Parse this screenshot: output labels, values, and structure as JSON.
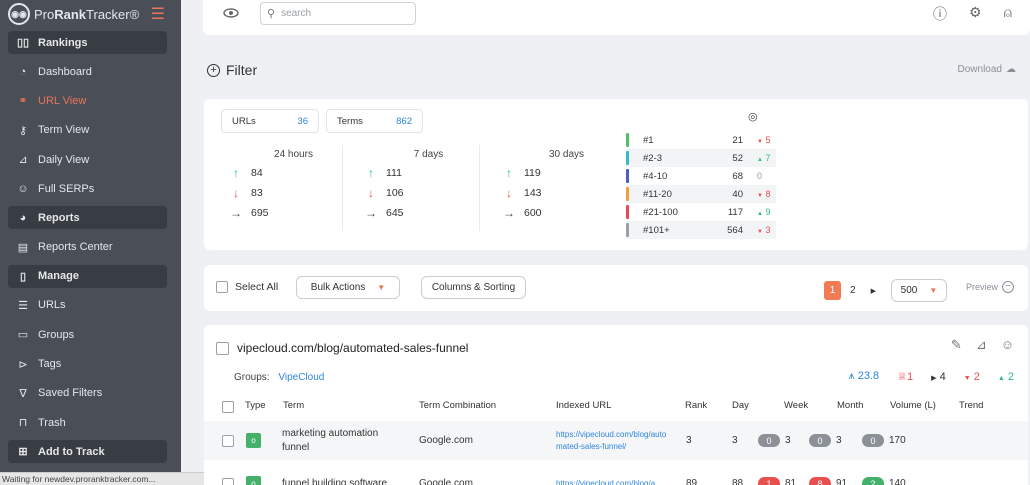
{
  "brand": {
    "name_prefix": "Pro",
    "name_bold": "Rank",
    "name_suffix": "Tracker®"
  },
  "sidebar": {
    "items": [
      {
        "label": "Rankings",
        "type": "section",
        "icon": "rankings-icon",
        "glyph": "▯▯"
      },
      {
        "label": "Dashboard",
        "type": "item",
        "icon": "dashboard-icon",
        "glyph": "◔"
      },
      {
        "label": "URL View",
        "type": "item",
        "icon": "link-icon",
        "glyph": "⚭",
        "active": true
      },
      {
        "label": "Term View",
        "type": "item",
        "icon": "key-icon",
        "glyph": "⚷"
      },
      {
        "label": "Daily View",
        "type": "item",
        "icon": "chart-line-icon",
        "glyph": "⊿"
      },
      {
        "label": "Full SERPs",
        "type": "item",
        "icon": "robot-icon",
        "glyph": "☺"
      },
      {
        "label": "Reports",
        "type": "section",
        "icon": "pie-icon",
        "glyph": "◕"
      },
      {
        "label": "Reports Center",
        "type": "item",
        "icon": "report-icon",
        "glyph": "▤"
      },
      {
        "label": "Manage",
        "type": "section",
        "icon": "manage-icon",
        "glyph": "▯"
      },
      {
        "label": "URLs",
        "type": "item",
        "icon": "list-icon",
        "glyph": "☰"
      },
      {
        "label": "Groups",
        "type": "item",
        "icon": "folder-icon",
        "glyph": "▭"
      },
      {
        "label": "Tags",
        "type": "item",
        "icon": "tag-icon",
        "glyph": "⊳"
      },
      {
        "label": "Saved Filters",
        "type": "item",
        "icon": "filter-icon",
        "glyph": "∇"
      },
      {
        "label": "Trash",
        "type": "item",
        "icon": "trash-icon",
        "glyph": "⊓"
      },
      {
        "label": "Add to Track",
        "type": "section",
        "icon": "add-box-icon",
        "glyph": "⊞"
      }
    ]
  },
  "status_bar": "Waiting for newdev.proranktracker.com...",
  "search": {
    "placeholder": "search"
  },
  "filter": {
    "title": "Filter",
    "download": "Download"
  },
  "summary": {
    "urls_label": "URLs",
    "urls_count": "36",
    "terms_label": "Terms",
    "terms_count": "862",
    "periods": [
      {
        "label": "24 hours",
        "up": "84",
        "down": "83",
        "same": "695"
      },
      {
        "label": "7 days",
        "up": "111",
        "down": "106",
        "same": "645"
      },
      {
        "label": "30 days",
        "up": "119",
        "down": "143",
        "same": "600"
      }
    ],
    "ranks": [
      {
        "label": "#1",
        "count": "21",
        "change": "5",
        "dir": "down",
        "color": "#4cc06a"
      },
      {
        "label": "#2-3",
        "count": "52",
        "change": "7",
        "dir": "up",
        "color": "#38b9c9"
      },
      {
        "label": "#4-10",
        "count": "68",
        "change": "0",
        "dir": "zero",
        "color": "#4760c8"
      },
      {
        "label": "#11-20",
        "count": "40",
        "change": "8",
        "dir": "down",
        "color": "#f0a040"
      },
      {
        "label": "#21-100",
        "count": "117",
        "change": "9",
        "dir": "up",
        "color": "#e64a5a"
      },
      {
        "label": "#101+",
        "count": "564",
        "change": "3",
        "dir": "down",
        "color": "#9aa0a6"
      }
    ]
  },
  "toolbar": {
    "select_all": "Select All",
    "bulk_actions": "Bulk Actions",
    "columns_sorting": "Columns & Sorting",
    "page_current": "1",
    "page_next": "2",
    "per_page": "500",
    "preview": "Preview"
  },
  "url_card": {
    "url": "vipecloud.com/blog/automated-sales-funnel",
    "groups_label": "Groups:",
    "group": "VipeCloud",
    "avg_rank": "23.8",
    "trophy": "1",
    "same": "4",
    "down": "2",
    "up": "2",
    "columns": [
      "Type",
      "Term",
      "Term Combination",
      "Indexed URL",
      "Rank",
      "Day",
      "Week",
      "Month",
      "Volume (L)",
      "Trend"
    ],
    "rows": [
      {
        "type": "o",
        "term": "marketing automation funnel",
        "combination": "Google.com",
        "indexed_url": "https://vipecloud.com/blog/automated-sales-funnel/",
        "rank": "3",
        "day": "3",
        "week_chip": "0",
        "week": "3",
        "month_chip": "0",
        "month": "3",
        "vol_chip": "0",
        "volume": "170",
        "week_color": "grey",
        "month_color": "grey",
        "vol_color": "grey"
      },
      {
        "type": "o",
        "term": "funnel building software",
        "combination": "Google.com",
        "indexed_url": "https://vipecloud.com/blog/a",
        "rank": "89",
        "day": "88",
        "week_chip": "1",
        "week": "81",
        "month_chip": "8",
        "month": "91",
        "vol_chip": "2",
        "volume": "140",
        "week_color": "red",
        "month_color": "red",
        "vol_color": "green"
      }
    ]
  }
}
